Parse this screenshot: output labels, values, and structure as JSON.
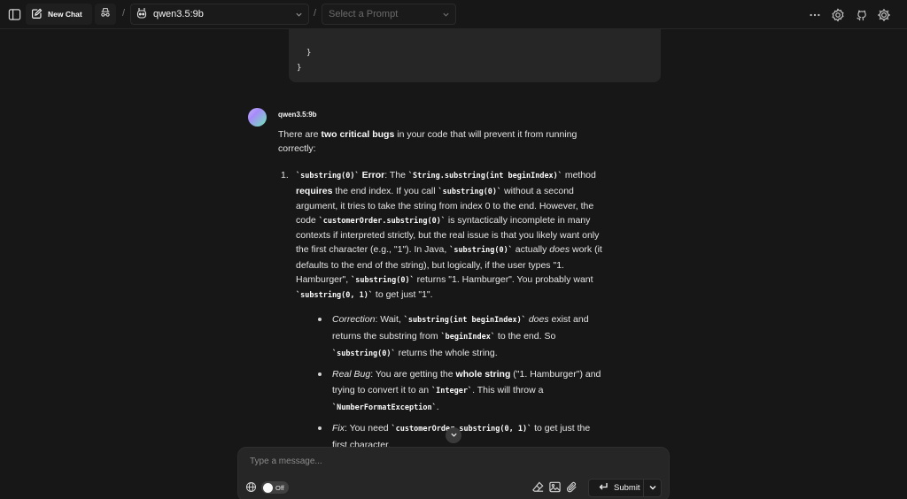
{
  "header": {
    "new_chat_label": "New Chat",
    "separator": "/",
    "model": "qwen3.5:9b",
    "prompt_placeholder": "Select a Prompt"
  },
  "code_tail": {
    "line1": "}",
    "line2": "}"
  },
  "message": {
    "model_name": "qwen3.5:9b",
    "intro_pre": "There are ",
    "intro_bold": "two critical bugs",
    "intro_post": " in your code that will prevent it from running correctly:",
    "item1": {
      "number": "1.",
      "c1": "`substring(0)`",
      "t1": " ",
      "b1": "Error",
      "t2": ": The ",
      "c2": "`String.substring(int beginIndex)`",
      "t3": " method ",
      "b2": "requires",
      "t4": " the end index. If you call ",
      "c3": "`substring(0)`",
      "t5": " without a second argument, it tries to take the string from index 0 to the end. However, the code ",
      "c4": "`customerOrder.substring(0)`",
      "t6": " is syntactically incomplete in many contexts if interpreted strictly, but the real issue is that you likely want only the first character (e.g., \"1\"). In Java, ",
      "c5": "`substring(0)`",
      "t7": " actually ",
      "i1": "does",
      "t8": " work (it defaults to the end of the string), but logically, if the user types \"1. Hamburger\", ",
      "c6": "`substring(0)`",
      "t9": " returns \"1. Hamburger\". You probably want ",
      "c7": "`substring(0, 1)`",
      "t10": " to get just \"1\"."
    },
    "bullets": {
      "b1_em": "Correction",
      "b1_t1": ": Wait, ",
      "b1_c1": "`substring(int beginIndex)`",
      "b1_t2": " ",
      "b1_em2": "does",
      "b1_t3": " exist and returns the substring from ",
      "b1_c2": "`beginIndex`",
      "b1_t4": " to the end. So ",
      "b1_c3": "`substring(0)`",
      "b1_t5": " returns the whole string.",
      "b2_em": "Real Bug",
      "b2_t1": ": You are getting the ",
      "b2_b": "whole string",
      "b2_t2": " (\"1. Hamburger\") and trying to convert it to an ",
      "b2_c1": "`Integer`",
      "b2_t3": ". This will throw a ",
      "b2_c2": "`NumberFormatException`",
      "b2_t4": ".",
      "b3_em": "Fix",
      "b3_t1": ": You need ",
      "b3_c1": "`customerOrder.substring(0, 1)`",
      "b3_t2": " to get just the first character."
    }
  },
  "composer": {
    "placeholder": "Type a message...",
    "toggle_label": "Off",
    "submit_label": "Submit"
  },
  "icons": [
    "sidebar-toggle-icon",
    "edit-icon",
    "incognito-icon",
    "robot-icon",
    "chevron-down-icon",
    "more-icon",
    "settings-icon",
    "github-icon",
    "gear-icon",
    "globe-icon",
    "eraser-icon",
    "image-icon",
    "paperclip-icon",
    "enter-icon"
  ]
}
